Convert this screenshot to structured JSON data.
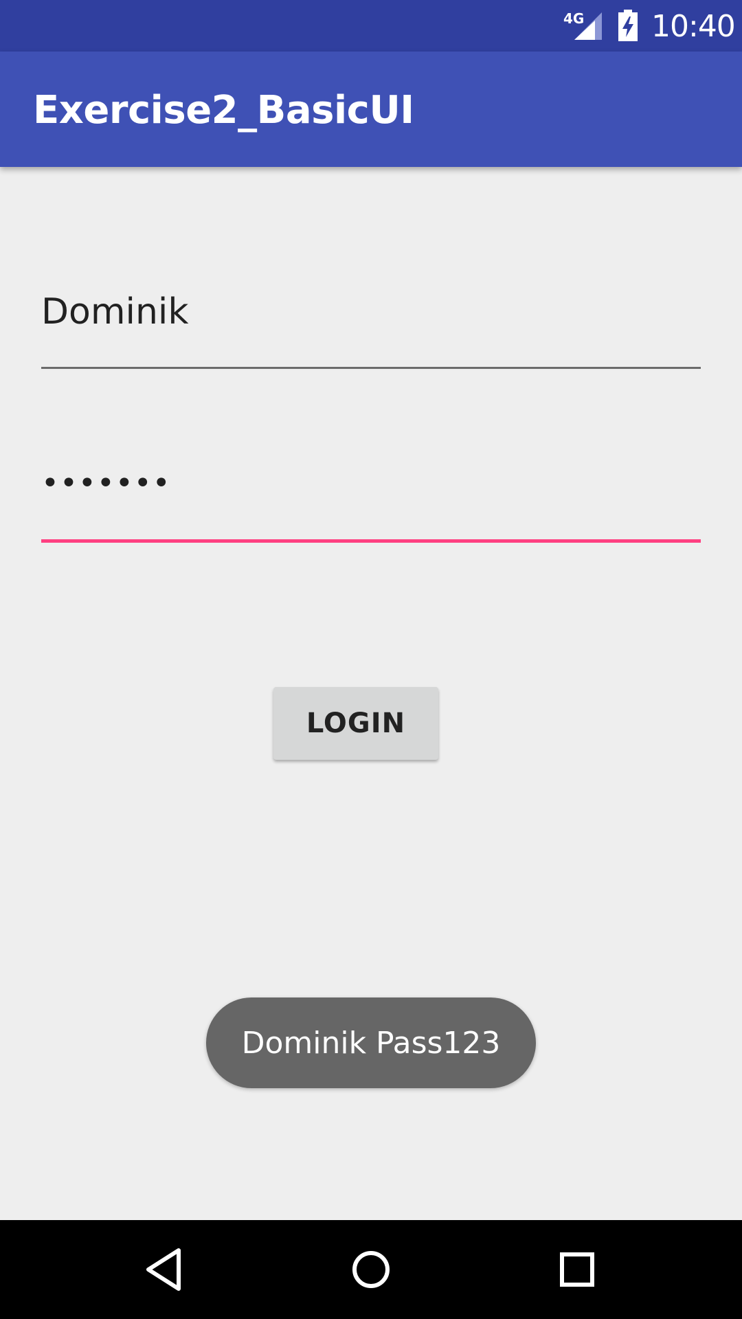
{
  "status_bar": {
    "network": "4G",
    "time": "10:40",
    "icons": [
      "signal-icon",
      "battery-charging-icon"
    ]
  },
  "app_bar": {
    "title": "Exercise2_BasicUI",
    "color": "#3f51b5"
  },
  "form": {
    "username_value": "Dominik",
    "password_masked": "•••••••",
    "login_label": "LOGIN",
    "accent_color": "#ff4081"
  },
  "toast": {
    "message": "Dominik Pass123"
  },
  "nav_bar": {
    "icons": [
      "back-icon",
      "home-icon",
      "recents-icon"
    ]
  }
}
